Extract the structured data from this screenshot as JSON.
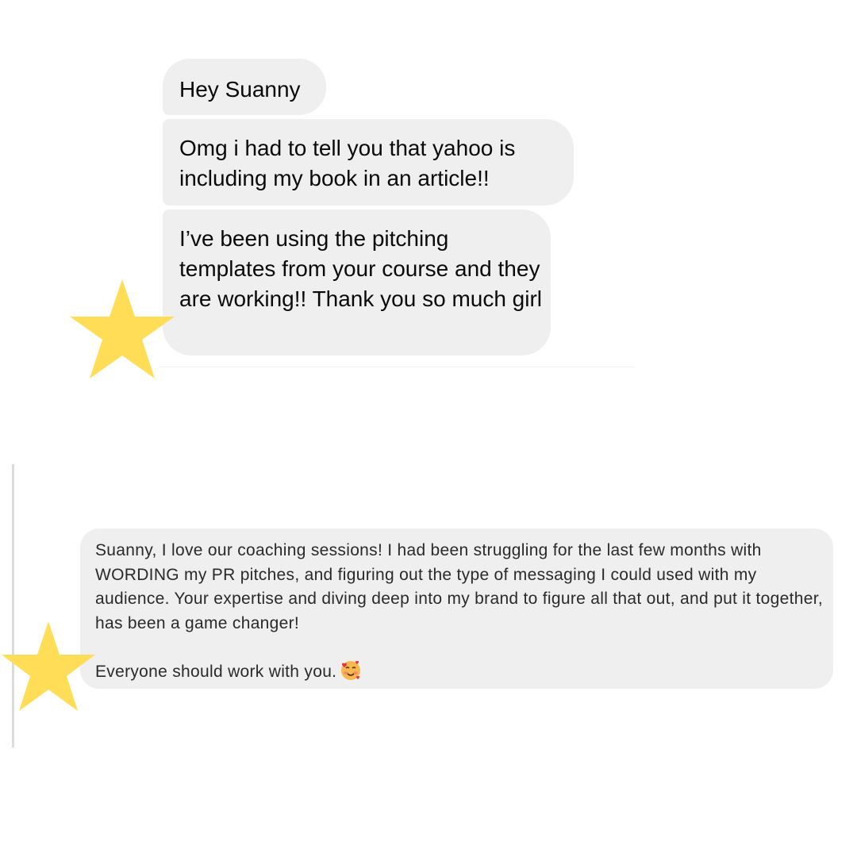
{
  "messages": [
    {
      "text": "Hey Suanny"
    },
    {
      "text": "Omg i had to tell you that yahoo is including my book in an article!!"
    },
    {
      "text": "I’ve been using the pitching templates from your course and they are working!! Thank you so much girl"
    }
  ],
  "testimonial": {
    "paragraph": "Suanny, I love our coaching sessions! I had been struggling for the last few months with WORDING my PR pitches, and figuring out the type of messaging I could used with my audience. Your expertise and diving deep into my brand to figure all that out, and put it together, has been a game changer!",
    "closing": "Everyone should work with you.",
    "emoji_icon": "smiling-face-with-hearts-icon"
  },
  "decorations": {
    "star_color": "#FFDD57",
    "star_icon": "star-icon"
  }
}
